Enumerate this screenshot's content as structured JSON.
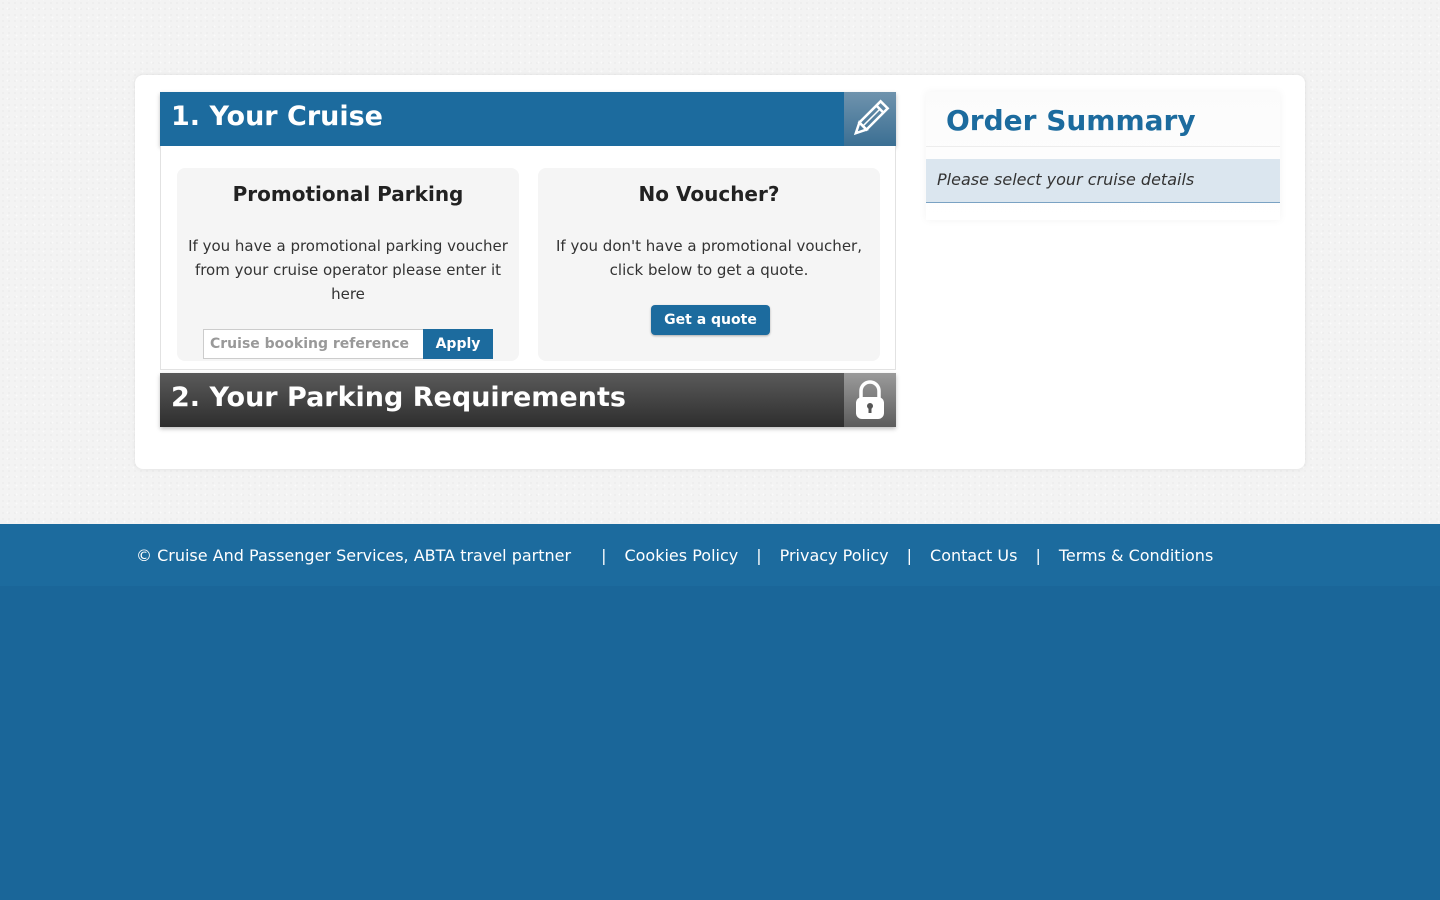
{
  "step1": {
    "title": "1. Your Cruise",
    "icon": "pencil-icon",
    "promo": {
      "heading": "Promotional Parking",
      "text": "If you have a promotional parking voucher from your cruise operator please enter it here",
      "input_placeholder": "Cruise booking reference",
      "apply_label": "Apply"
    },
    "no_voucher": {
      "heading": "No Voucher?",
      "text": "If you don't have a promotional voucher, click below to get a quote.",
      "quote_label": "Get a quote"
    }
  },
  "step2": {
    "title": "2. Your Parking Requirements",
    "icon": "lock-icon"
  },
  "summary": {
    "title": "Order Summary",
    "notice": "Please select your cruise details"
  },
  "footer": {
    "copyright": "© Cruise And Passenger Services, ABTA travel partner",
    "separator": "|",
    "links": [
      "Cookies Policy",
      "Privacy Policy",
      "Contact Us",
      "Terms & Conditions"
    ]
  },
  "colors": {
    "brand": "#1c6b9e",
    "footer_bg": "#1a6699",
    "locked": "#3a3a3a"
  }
}
